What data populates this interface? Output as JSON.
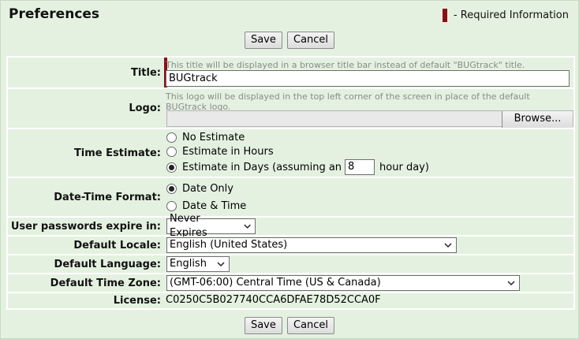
{
  "header": {
    "title": "Preferences",
    "required_legend": "- Required Information",
    "required_color": "#8b0e14"
  },
  "actions": {
    "save_label": "Save",
    "cancel_label": "Cancel"
  },
  "fields": {
    "title": {
      "label": "Title:",
      "hint": "This title will be displayed in a browser title bar instead of default \"BUGtrack\" title.",
      "value": "BUGtrack"
    },
    "logo": {
      "label": "Logo:",
      "hint": "This logo will be displayed in the top left corner of the screen in place of the default BUGtrack logo.",
      "browse_label": "Browse..."
    },
    "time_estimate": {
      "label": "Time Estimate:",
      "options": [
        "No Estimate",
        "Estimate in Hours",
        "Estimate in Days (assuming an"
      ],
      "selected": "Estimate in Days (assuming an",
      "hours_per_day": "8",
      "suffix": "hour day)"
    },
    "date_time_format": {
      "label": "Date-Time Format:",
      "options": [
        "Date Only",
        "Date & Time"
      ],
      "selected": "Date Only"
    },
    "password_expiry": {
      "label": "User passwords expire in:",
      "value": "Never Expires"
    },
    "default_locale": {
      "label": "Default Locale:",
      "value": "English (United States)"
    },
    "default_language": {
      "label": "Default Language:",
      "value": "English"
    },
    "default_time_zone": {
      "label": "Default Time Zone:",
      "value": "(GMT-06:00) Central Time (US & Canada)"
    },
    "license": {
      "label": "License:",
      "value": "C0250C5B027740CCA6DFAE78D52CCA0F"
    }
  },
  "icons": {
    "chevron": "chevron-down-icon"
  }
}
